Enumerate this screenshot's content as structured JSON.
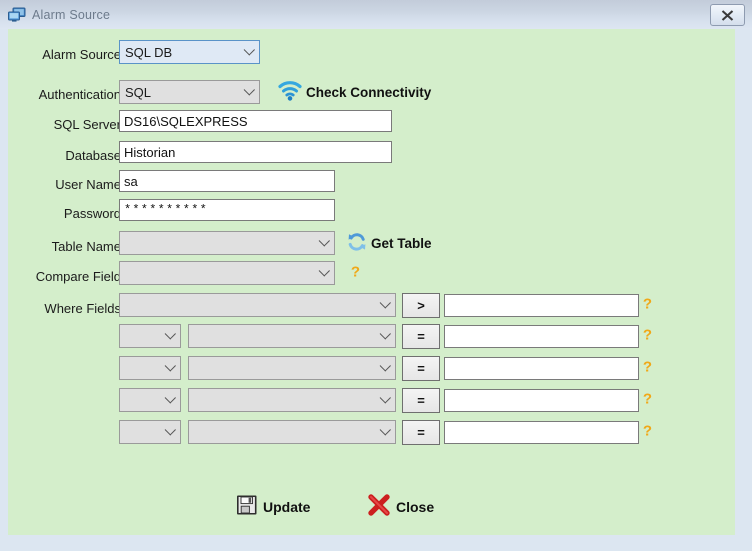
{
  "window": {
    "title": "Alarm Source",
    "title_icon": "monitors-icon",
    "close_label": "✕",
    "bg_color": "#d4eecb",
    "titlebar_color": "#d6e0ed"
  },
  "form": {
    "alarm_source": {
      "label": "Alarm Source",
      "value": "SQL DB",
      "enabled": true
    },
    "authentication": {
      "label": "Authentication",
      "value": "SQL",
      "enabled": false
    },
    "check_connectivity": {
      "label": "Check Connectivity",
      "icon": "wifi-icon"
    },
    "sql_server": {
      "label": "SQL Server",
      "value": "DS16\\SQLEXPRESS",
      "placeholder": ""
    },
    "database": {
      "label": "Database",
      "value": "Historian",
      "placeholder": ""
    },
    "user_name": {
      "label": "User Name",
      "value": "sa",
      "placeholder": ""
    },
    "password": {
      "label": "Password",
      "value": "**********",
      "placeholder": ""
    },
    "table_name": {
      "label": "Table Name",
      "value": "",
      "enabled": false
    },
    "get_table": {
      "label": "Get Table",
      "icon": "refresh-icon"
    },
    "compare_field": {
      "label": "Compare Field",
      "value": "",
      "enabled": false
    },
    "where_fields": {
      "label": "Where Fields",
      "rows": [
        {
          "logic": null,
          "field": "",
          "operator": ">",
          "value": "",
          "help": "?"
        },
        {
          "logic": "",
          "field": "",
          "operator": "=",
          "value": "",
          "help": "?"
        },
        {
          "logic": "",
          "field": "",
          "operator": "=",
          "value": "",
          "help": "?"
        },
        {
          "logic": "",
          "field": "",
          "operator": "=",
          "value": "",
          "help": "?"
        },
        {
          "logic": "",
          "field": "",
          "operator": "=",
          "value": "",
          "help": "?"
        }
      ]
    }
  },
  "footer": {
    "update": {
      "label": "Update",
      "icon": "floppy-save-icon"
    },
    "close": {
      "label": "Close",
      "icon": "red-x-icon"
    }
  },
  "colors": {
    "accent_blue": "#2e9ad6",
    "help_orange": "#f0a818",
    "close_red": "#cc1f1f",
    "body_green": "#d4eecb"
  }
}
